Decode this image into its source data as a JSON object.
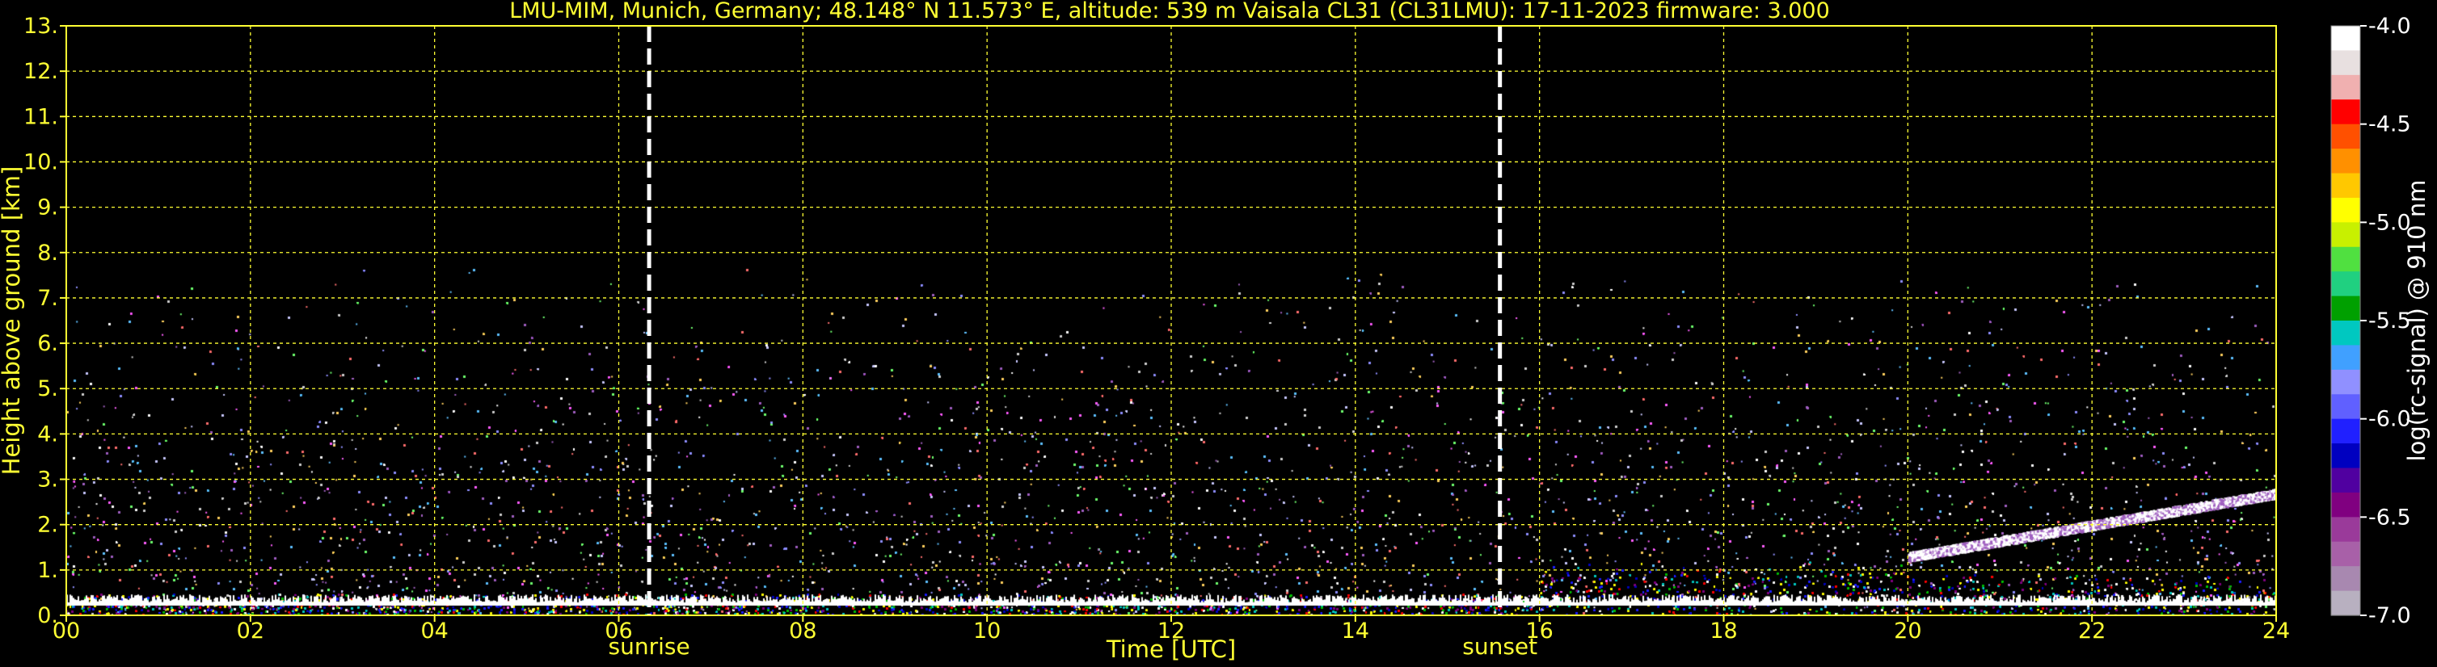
{
  "chart_data": {
    "type": "heatmap",
    "title": "LMU-MIM, Munich, Germany; 48.148° N 11.573° E, altitude: 539 m    Vaisala CL31 (CL31LMU): 17-11-2023    firmware: 3.000",
    "xlabel": "Time [UTC]",
    "ylabel": "Height above ground [km]",
    "xlim": [
      0,
      24
    ],
    "ylim": [
      0,
      13
    ],
    "x_ticks": [
      "00",
      "02",
      "04",
      "06",
      "08",
      "10",
      "12",
      "14",
      "16",
      "18",
      "20",
      "22",
      "24"
    ],
    "y_ticks": [
      "0.",
      "1.",
      "2.",
      "3.",
      "4.",
      "5.",
      "6.",
      "7.",
      "8.",
      "9.",
      "10.",
      "11.",
      "12.",
      "13."
    ],
    "grid": true,
    "grid_color": "#ffff33",
    "events": [
      {
        "label": "sunrise",
        "x": 6.33
      },
      {
        "label": "sunset",
        "x": 15.57
      }
    ],
    "measurement_ceiling_km": 7.7,
    "colorbar": {
      "label": "log(rc-signal) @ 910 nm",
      "range": [
        -7.0,
        -4.0
      ],
      "ticks": [
        "-4.0",
        "-4.5",
        "-5.0",
        "-5.5",
        "-6.0",
        "-6.5",
        "-7.0"
      ],
      "colors": [
        "#ffffff",
        "#e8e0e0",
        "#f0b0b0",
        "#ff0000",
        "#ff5000",
        "#ff9000",
        "#ffc800",
        "#ffff00",
        "#c8f000",
        "#50e040",
        "#20d080",
        "#00a000",
        "#00c8c0",
        "#40a0ff",
        "#9090ff",
        "#6060ff",
        "#2020ff",
        "#0000c0",
        "#5000a0",
        "#800080",
        "#9a3a9a",
        "#a860a8",
        "#a888b0",
        "#b8b0c0"
      ]
    }
  }
}
